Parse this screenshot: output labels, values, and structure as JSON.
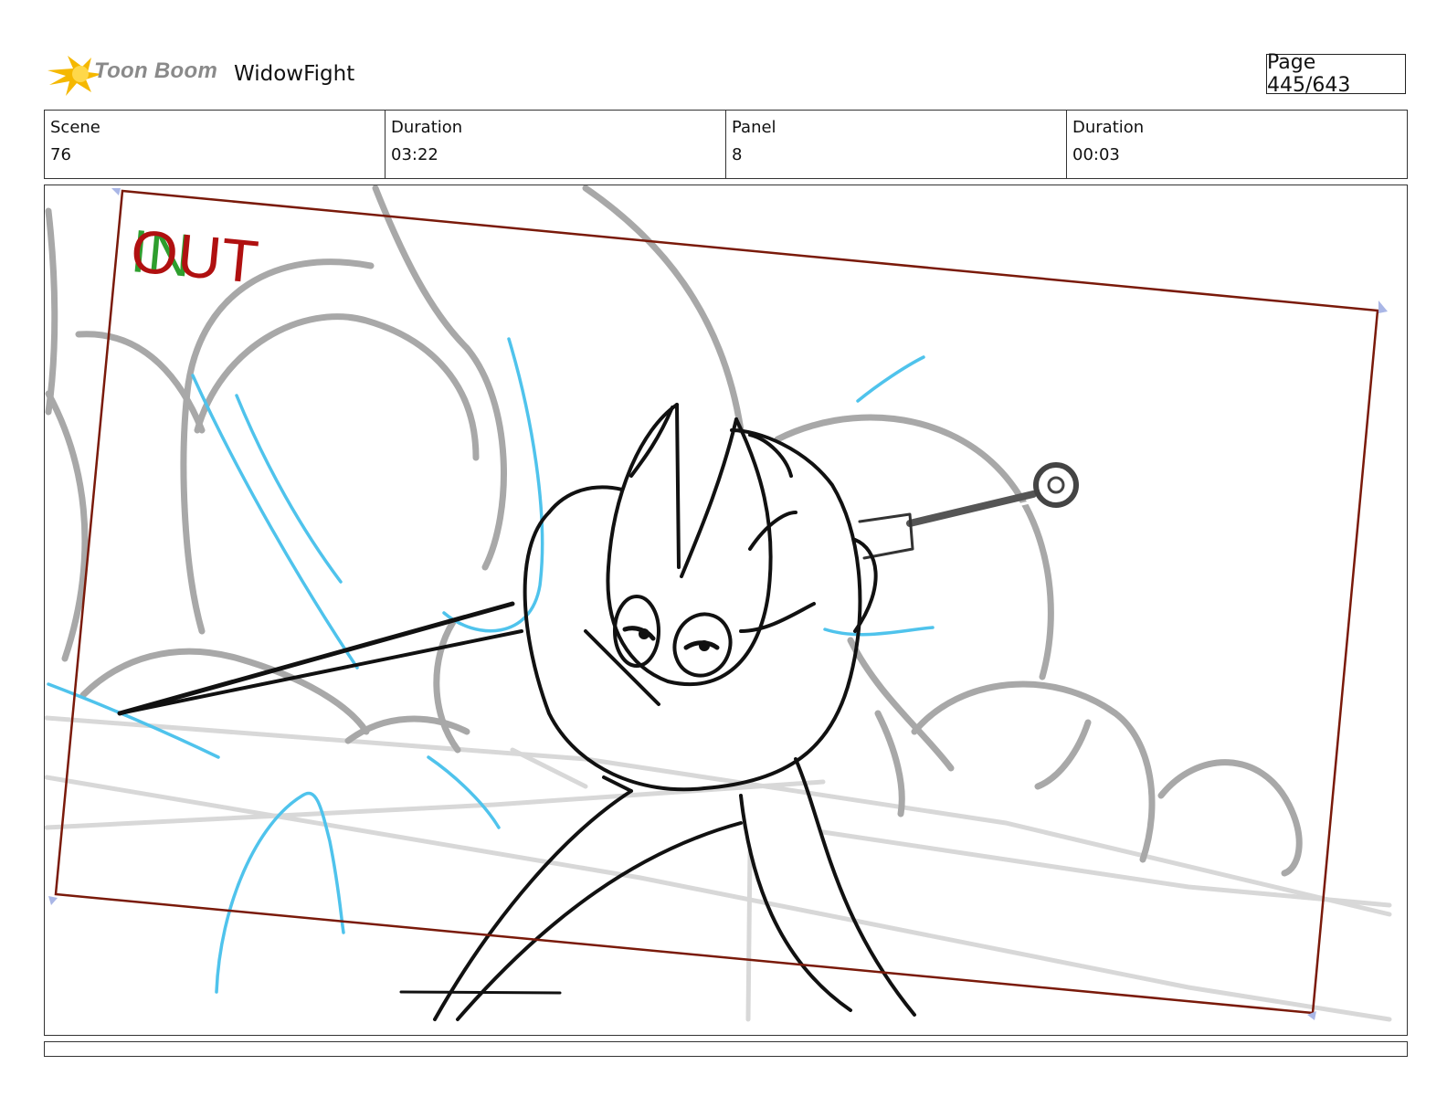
{
  "header": {
    "brand": "Toon Boom",
    "project": "WidowFight",
    "page": "Page 445/643"
  },
  "info": {
    "scene_label": "Scene",
    "scene_value": "76",
    "scene_duration_label": "Duration",
    "scene_duration_value": "03:22",
    "panel_label": "Panel",
    "panel_value": "8",
    "panel_duration_label": "Duration",
    "panel_duration_value": "00:03"
  },
  "panel": {
    "marker_in": "IN",
    "marker_out": "OUT",
    "colors": {
      "frame": "#7a1a0a",
      "in": "#2e9e2e",
      "out": "#b01010",
      "rough": "#a8a8a8",
      "ground": "#d8d8d8",
      "effects": "#4fc3ec",
      "ink": "#111111"
    }
  }
}
